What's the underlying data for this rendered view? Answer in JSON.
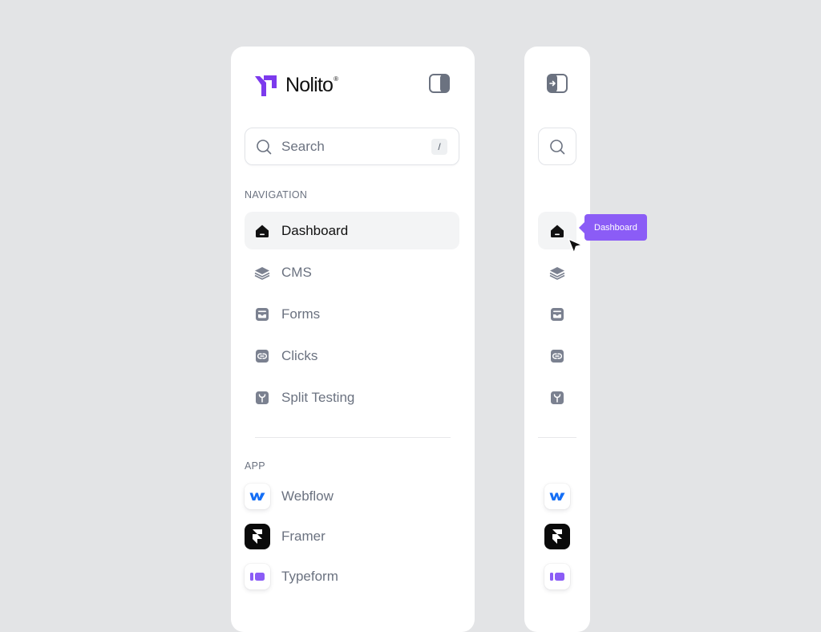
{
  "brand": {
    "name": "Nolito",
    "mark": "®",
    "color": "#7c3aed"
  },
  "search": {
    "placeholder": "Search",
    "shortcut": "/"
  },
  "sections": {
    "navigation": "NAVIGATION",
    "app": "APP"
  },
  "nav": [
    {
      "label": "Dashboard",
      "icon": "home-icon",
      "active": true
    },
    {
      "label": "CMS",
      "icon": "layers-icon",
      "active": false
    },
    {
      "label": "Forms",
      "icon": "form-icon",
      "active": false
    },
    {
      "label": "Clicks",
      "icon": "link-icon",
      "active": false
    },
    {
      "label": "Split Testing",
      "icon": "split-icon",
      "active": false
    }
  ],
  "apps": [
    {
      "label": "Webflow",
      "icon": "webflow-logo-icon"
    },
    {
      "label": "Framer",
      "icon": "framer-logo-icon"
    },
    {
      "label": "Typeform",
      "icon": "typeform-logo-icon"
    }
  ],
  "tooltip": {
    "text": "Dashboard",
    "color": "#8b5cf6"
  },
  "colors": {
    "background": "#e3e4e6",
    "panel": "#ffffff",
    "active_bg": "#f3f4f5",
    "muted_text": "#6b7280"
  }
}
